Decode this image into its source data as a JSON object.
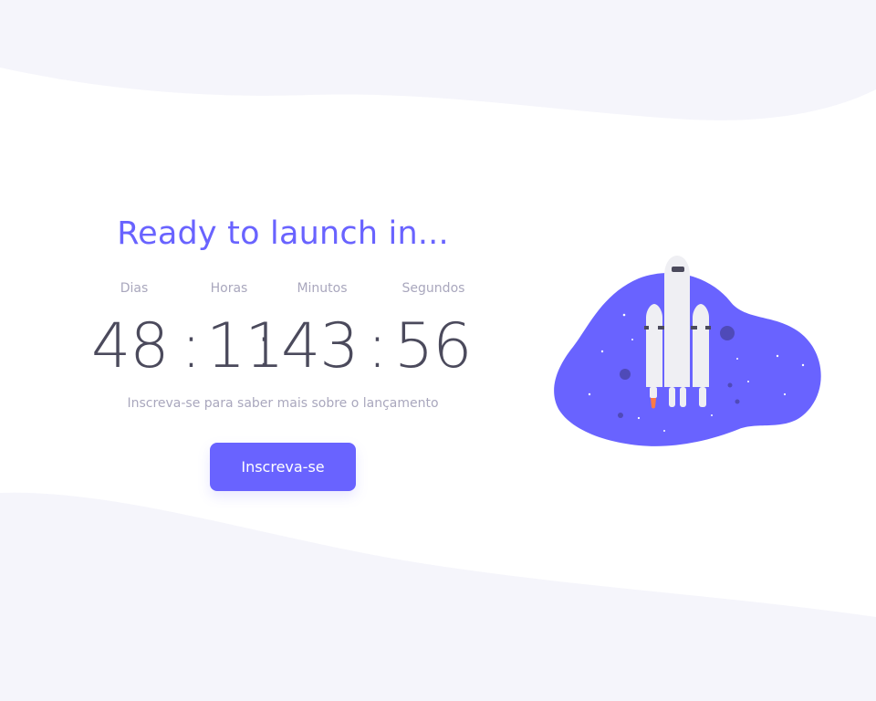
{
  "colors": {
    "accent": "#6963ff",
    "text_muted": "#a9a7bd",
    "text_dark": "#4b4a5c",
    "wave_background": "#f5f5fb"
  },
  "hero": {
    "title": "Ready to launch in...",
    "units": {
      "days": "Dias",
      "hours": "Horas",
      "minutes": "Minutos",
      "seconds": "Segundos"
    },
    "countdown": {
      "days": "48",
      "hours": "11",
      "minutes": "43",
      "seconds": "56",
      "separator": ":"
    },
    "subtitle": "Inscreva-se para saber mais sobre o lançamento",
    "cta_label": "Inscreva-se"
  },
  "illustration": {
    "icon": "rocket-launch-illustration"
  }
}
